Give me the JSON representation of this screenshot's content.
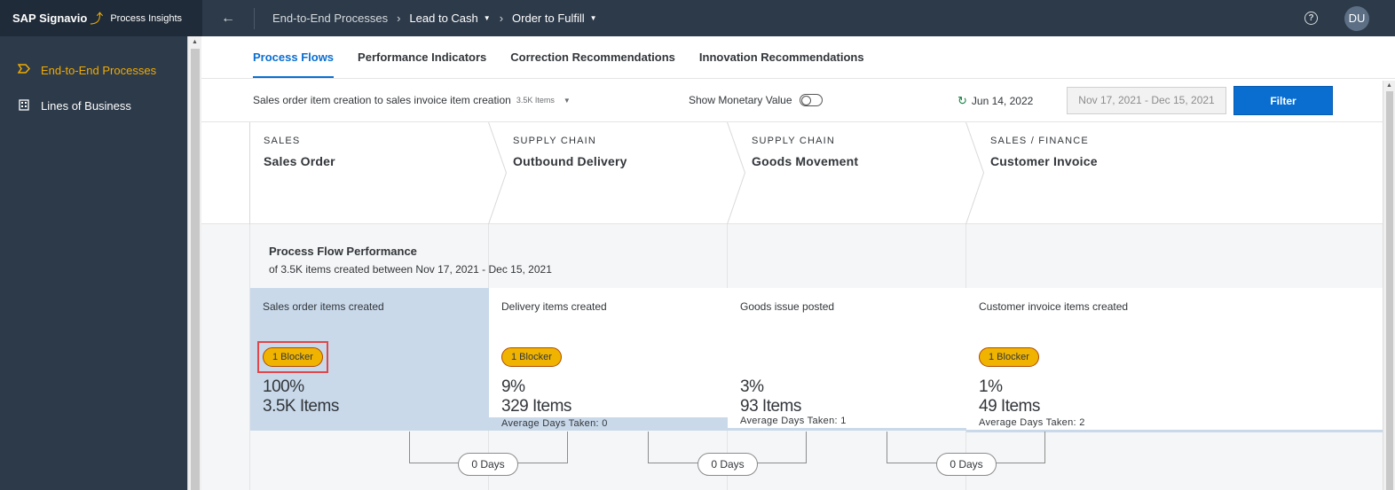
{
  "header": {
    "brand_name": "SAP Signavio",
    "brand_app": "Process Insights",
    "back_icon": "arrow-left-icon",
    "breadcrumb": [
      "End-to-End Processes",
      "Lead to Cash",
      "Order to Fulfill"
    ],
    "help_icon": "help-icon",
    "avatar_initials": "DU"
  },
  "sidebar": {
    "items": [
      {
        "label": "End-to-End Processes",
        "icon": "process-chevron-icon",
        "active": true
      },
      {
        "label": "Lines of Business",
        "icon": "building-icon",
        "active": false
      }
    ]
  },
  "tabs": [
    {
      "label": "Process Flows",
      "active": true
    },
    {
      "label": "Performance Indicators",
      "active": false
    },
    {
      "label": "Correction Recommendations",
      "active": false
    },
    {
      "label": "Innovation Recommendations",
      "active": false
    }
  ],
  "filterbar": {
    "flow_select": "Sales order item creation to sales invoice item creation",
    "flow_count": "3.5K Items",
    "monetary_label": "Show Monetary Value",
    "monetary_on": false,
    "refresh_date": "Jun 14, 2022",
    "date_range": "Nov 17, 2021 - Dec 15, 2021",
    "filter_label": "Filter"
  },
  "stages": [
    {
      "category": "SALES",
      "name": "Sales Order"
    },
    {
      "category": "SUPPLY CHAIN",
      "name": "Outbound Delivery"
    },
    {
      "category": "SUPPLY CHAIN",
      "name": "Goods Movement"
    },
    {
      "category": "SALES / FINANCE",
      "name": "Customer Invoice"
    }
  ],
  "performance": {
    "title": "Process Flow Performance",
    "subtitle": "of 3.5K items created between Nov 17, 2021 - Dec 15, 2021",
    "steps": [
      {
        "label": "Sales order items created",
        "blocker": "1 Blocker",
        "percent": "100%",
        "items": "3.5K Items",
        "avg_days": "",
        "share": 1.0
      },
      {
        "label": "Delivery items created",
        "blocker": "1 Blocker",
        "percent": "9%",
        "items": "329 Items",
        "avg_days": "Average Days Taken: 0",
        "share": 0.09
      },
      {
        "label": "Goods issue posted",
        "blocker": "",
        "percent": "3%",
        "items": "93 Items",
        "avg_days": "Average Days Taken: 1",
        "share": 0.03
      },
      {
        "label": "Customer invoice items created",
        "blocker": "1 Blocker",
        "percent": "1%",
        "items": "49 Items",
        "avg_days": "Average Days Taken: 2",
        "share": 0.01
      }
    ],
    "transitions": [
      "0 Days",
      "0 Days",
      "0 Days"
    ]
  },
  "colors": {
    "accent": "#0a6ed1",
    "nav_active": "#f0ab00",
    "shell": "#2d3a4a",
    "blocker": "#f0b400",
    "selected_card": "#c9d9ea"
  }
}
